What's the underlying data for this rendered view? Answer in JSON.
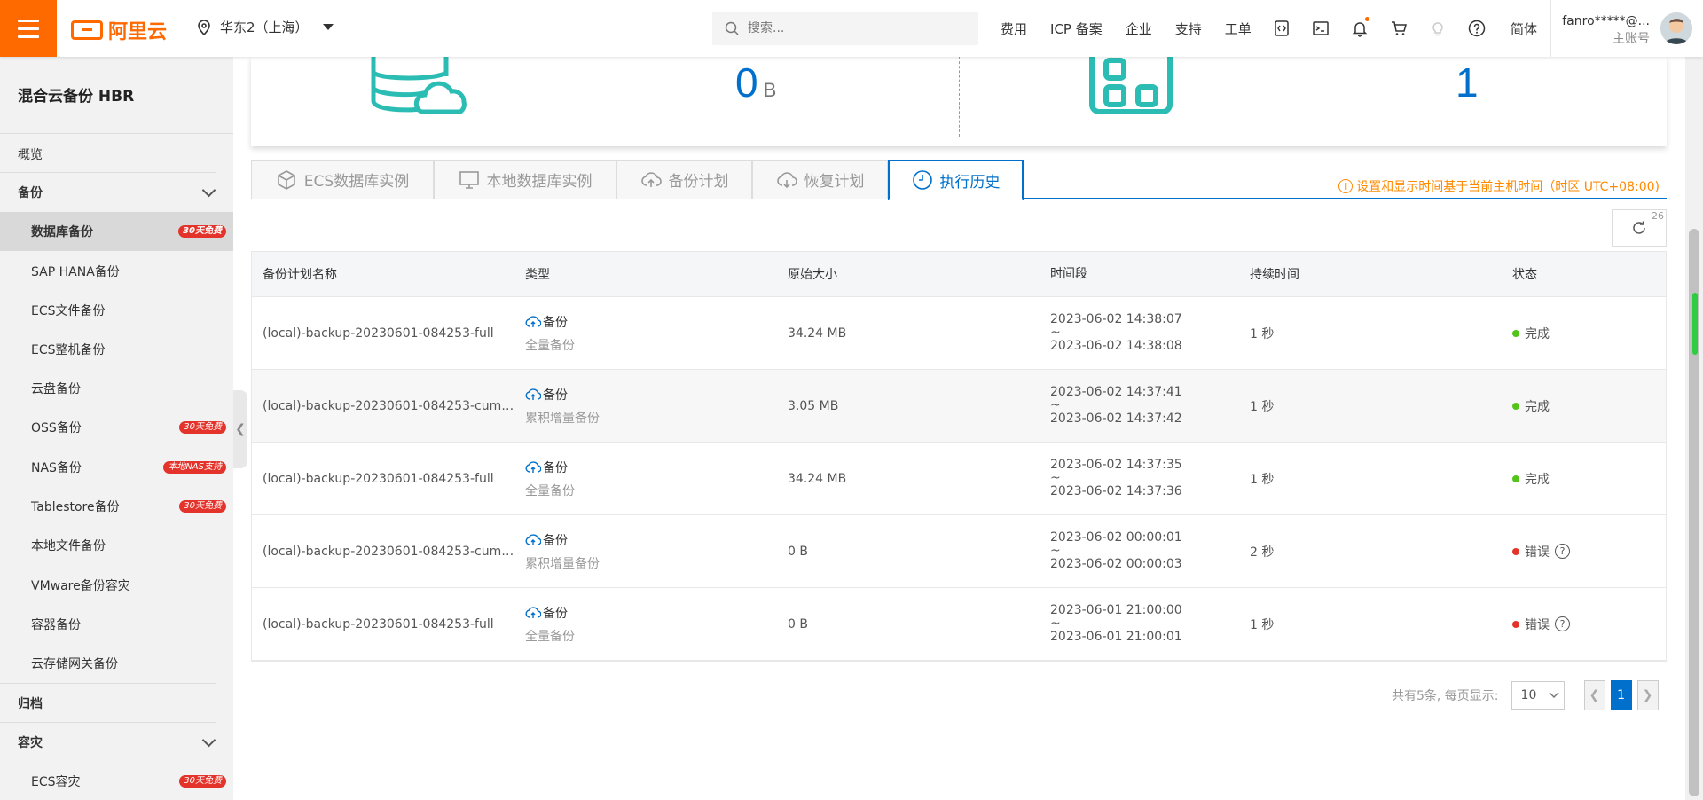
{
  "topbar": {
    "logo_text": "阿里云",
    "region": "华东2（上海）",
    "search_placeholder": "搜索...",
    "links": [
      "费用",
      "ICP 备案",
      "企业",
      "支持",
      "工单"
    ],
    "lang": "简体",
    "user_name": "fanro*****@...",
    "user_sub": "主账号"
  },
  "sidebar": {
    "title": "混合云备份 HBR",
    "overview": "概览",
    "section_backup": "备份",
    "items": [
      {
        "label": "数据库备份",
        "badge": "30天免费",
        "active": true
      },
      {
        "label": "SAP HANA备份",
        "badge": ""
      },
      {
        "label": "ECS文件备份",
        "badge": ""
      },
      {
        "label": "ECS整机备份",
        "badge": ""
      },
      {
        "label": "云盘备份",
        "badge": ""
      },
      {
        "label": "OSS备份",
        "badge": "30天免费"
      },
      {
        "label": "NAS备份",
        "badge": "本地NAS支持"
      },
      {
        "label": "Tablestore备份",
        "badge": "30天免费"
      },
      {
        "label": "本地文件备份",
        "badge": ""
      },
      {
        "label": "VMware备份容灾",
        "badge": ""
      },
      {
        "label": "容器备份",
        "badge": ""
      },
      {
        "label": "云存储网关备份",
        "badge": ""
      }
    ],
    "section_archive": "归档",
    "section_dr": "容灾",
    "dr_item": {
      "label": "ECS容灾",
      "badge": "30天免费"
    }
  },
  "summary": {
    "left_value": "0",
    "left_unit": "B",
    "right_value": "1"
  },
  "tabs": [
    {
      "label": "ECS数据库实例",
      "active": false
    },
    {
      "label": "本地数据库实例",
      "active": false
    },
    {
      "label": "备份计划",
      "active": false
    },
    {
      "label": "恢复计划",
      "active": false
    },
    {
      "label": "执行历史",
      "active": true
    }
  ],
  "timezone_note": "设置和显示时间基于当前主机时间（时区 UTC+08:00)",
  "refresh_count": "26",
  "table": {
    "headers": [
      "备份计划名称",
      "类型",
      "原始大小",
      "时间段",
      "持续时间",
      "状态"
    ],
    "rows": [
      {
        "name": "(local)-backup-20230601-084253-full",
        "type": "备份",
        "subtype": "全量备份",
        "size": "34.24 MB",
        "start": "2023-06-02 14:38:07",
        "sep": "~",
        "end": "2023-06-02 14:38:08",
        "duration": "1 秒",
        "status": "完成",
        "ok": true
      },
      {
        "name": "(local)-backup-20230601-084253-cumul...",
        "type": "备份",
        "subtype": "累积增量备份",
        "size": "3.05 MB",
        "start": "2023-06-02 14:37:41",
        "sep": "~",
        "end": "2023-06-02 14:37:42",
        "duration": "1 秒",
        "status": "完成",
        "ok": true
      },
      {
        "name": "(local)-backup-20230601-084253-full",
        "type": "备份",
        "subtype": "全量备份",
        "size": "34.24 MB",
        "start": "2023-06-02 14:37:35",
        "sep": "~",
        "end": "2023-06-02 14:37:36",
        "duration": "1 秒",
        "status": "完成",
        "ok": true
      },
      {
        "name": "(local)-backup-20230601-084253-cumul...",
        "type": "备份",
        "subtype": "累积增量备份",
        "size": "0 B",
        "start": "2023-06-02 00:00:01",
        "sep": "~",
        "end": "2023-06-02 00:00:03",
        "duration": "2 秒",
        "status": "错误",
        "ok": false
      },
      {
        "name": "(local)-backup-20230601-084253-full",
        "type": "备份",
        "subtype": "全量备份",
        "size": "0 B",
        "start": "2023-06-01 21:00:00",
        "sep": "~",
        "end": "2023-06-01 21:00:01",
        "duration": "1 秒",
        "status": "错误",
        "ok": false
      }
    ]
  },
  "pager": {
    "summary": "共有5条, 每页显示:",
    "page_size": "10",
    "current_page": "1"
  },
  "colors": {
    "accent": "#0070cc",
    "brand": "#ff6a00",
    "ok": "#52c41a",
    "error": "#e4332a"
  }
}
